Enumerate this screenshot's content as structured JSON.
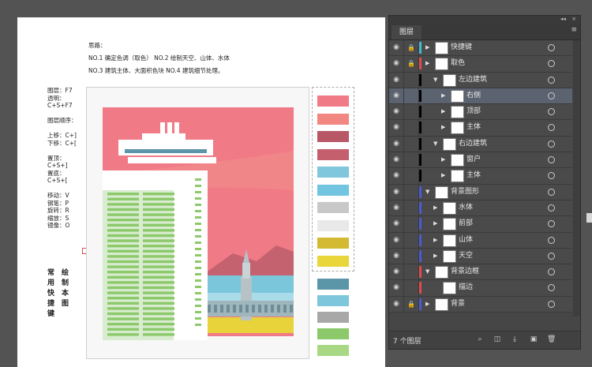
{
  "instructions": {
    "heading": "思路：",
    "line1": "NO.1 确定色调（取色）    NO.2 绘制天空、山体、水体",
    "line2": "NO.3 建筑主体、大面积色块   NO.4 建筑细节处理。"
  },
  "shortcuts": {
    "text": "图层：F7\n透明：\nC+S+F7\n\n图层顺序：\n\n上移：C+]\n下移：C+[\n\n置顶：\nC+S+]\n置底：\nC+S+[\n\n移动：V\n钢笔：P\n旋转：R\n缩放：S\n镜像：O"
  },
  "vertical_text": {
    "col1": "常\n用\n快\n捷\n键",
    "col2": "绘\n制\n本\n图"
  },
  "colors": {
    "sky": "#f07a86",
    "mountain": "#c4626f",
    "water": "#7cc6dc",
    "yellow": "#e8d33a",
    "green": "#8cc96a",
    "panel_bg": "#464646",
    "red_bar": "#e34b4b",
    "cyan_bar": "#3fbcd6",
    "blue_bar": "#4a5bd6"
  },
  "swatches_top": [
    "#f07a86",
    "#f28680",
    "#b85766",
    "#c4606e",
    "#80c6dc",
    "#72c5e0",
    "#c8c8c8",
    "#e9e9e9",
    "#d4ba32",
    "#e9d63b"
  ],
  "swatches_bottom": [
    "#5b95a8",
    "#7ec6dc",
    "#a8a8a8",
    "#8cc96a",
    "#a8d884"
  ],
  "panel": {
    "tab_label": "图层",
    "collapse": "◂◂",
    "close": "×",
    "menu_icon": "≡",
    "footer_count": "7 个图层",
    "layers": [
      {
        "name": "快捷键",
        "level": 0,
        "lock": true,
        "bar": "#3fbcd6",
        "expand": "right",
        "sel": false
      },
      {
        "name": "取色",
        "level": 0,
        "lock": true,
        "bar": "#e34b4b",
        "expand": "right",
        "sel": false
      },
      {
        "name": "左边建筑",
        "level": 1,
        "lock": false,
        "bar": "#000000",
        "expand": "down",
        "sel": false
      },
      {
        "name": "右侧",
        "level": 2,
        "lock": false,
        "bar": "#000000",
        "expand": "right",
        "sel": true
      },
      {
        "name": "顶部",
        "level": 2,
        "lock": false,
        "bar": "#000000",
        "expand": "right",
        "sel": false
      },
      {
        "name": "主体",
        "level": 2,
        "lock": false,
        "bar": "#000000",
        "expand": "right",
        "sel": false
      },
      {
        "name": "右边建筑",
        "level": 1,
        "lock": false,
        "bar": "#000000",
        "expand": "down",
        "sel": false
      },
      {
        "name": "窗户",
        "level": 2,
        "lock": false,
        "bar": "#000000",
        "expand": "right",
        "sel": false
      },
      {
        "name": "主体",
        "level": 2,
        "lock": false,
        "bar": "#000000",
        "expand": "right",
        "sel": false
      },
      {
        "name": "背景图形",
        "level": 0,
        "lock": false,
        "bar": "#4a5bd6",
        "expand": "down",
        "sel": false
      },
      {
        "name": "水体",
        "level": 1,
        "lock": false,
        "bar": "#4a5bd6",
        "expand": "right",
        "sel": false
      },
      {
        "name": "前部",
        "level": 1,
        "lock": false,
        "bar": "#4a5bd6",
        "expand": "right",
        "sel": false
      },
      {
        "name": "山体",
        "level": 1,
        "lock": false,
        "bar": "#4a5bd6",
        "expand": "right",
        "sel": false
      },
      {
        "name": "天空",
        "level": 1,
        "lock": false,
        "bar": "#4a5bd6",
        "expand": "right",
        "sel": false
      },
      {
        "name": "背景边框",
        "level": 0,
        "lock": false,
        "bar": "#e34b4b",
        "expand": "down",
        "sel": false
      },
      {
        "name": "描边",
        "level": 1,
        "lock": false,
        "bar": "#e34b4b",
        "expand": "none",
        "sel": false
      },
      {
        "name": "背景",
        "level": 0,
        "lock": true,
        "bar": "#4a5bd6",
        "expand": "right",
        "sel": false
      }
    ]
  }
}
